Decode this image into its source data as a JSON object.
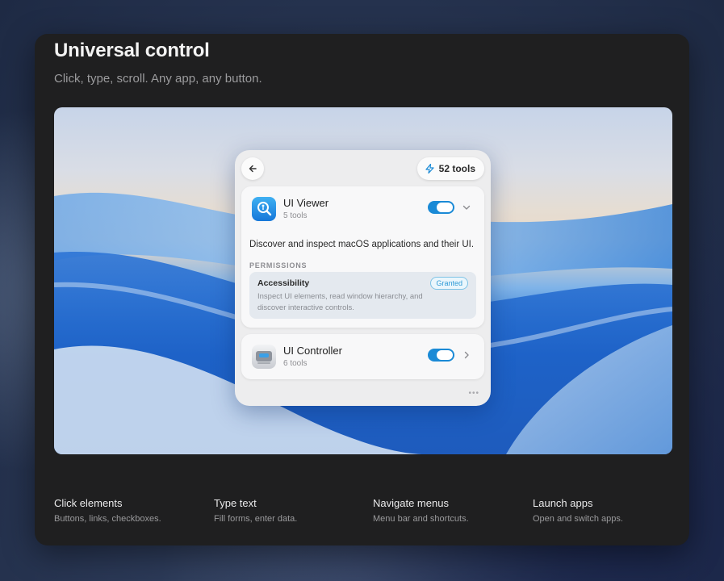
{
  "header": {
    "title": "Universal control",
    "subtitle": "Click, type, scroll. Any app, any button."
  },
  "panel": {
    "tools_count": "52 tools",
    "tools_icon": "bolt-icon",
    "back_icon": "arrow-left-icon",
    "more_label": "•••",
    "items": [
      {
        "name": "UI Viewer",
        "count": "5 tools",
        "icon": "magnifier-app-icon",
        "enabled": true,
        "expanded": true,
        "description": "Discover and inspect macOS applications and their UI.",
        "permissions_label": "PERMISSIONS",
        "permission": {
          "title": "Accessibility",
          "status": "Granted",
          "text": "Inspect UI elements, read window hierarchy, and discover interactive controls."
        }
      },
      {
        "name": "UI Controller",
        "count": "6 tools",
        "icon": "controller-app-icon",
        "enabled": true,
        "expanded": false
      }
    ]
  },
  "features": [
    {
      "title": "Click elements",
      "subtitle": "Buttons, links, checkboxes."
    },
    {
      "title": "Type text",
      "subtitle": "Fill forms, enter data."
    },
    {
      "title": "Navigate menus",
      "subtitle": "Menu bar and shortcuts."
    },
    {
      "title": "Launch apps",
      "subtitle": "Open and switch apps."
    }
  ],
  "colors": {
    "accent": "#1a8ad6",
    "card_bg": "#1f1f20",
    "badge": "#2f9ad6"
  }
}
